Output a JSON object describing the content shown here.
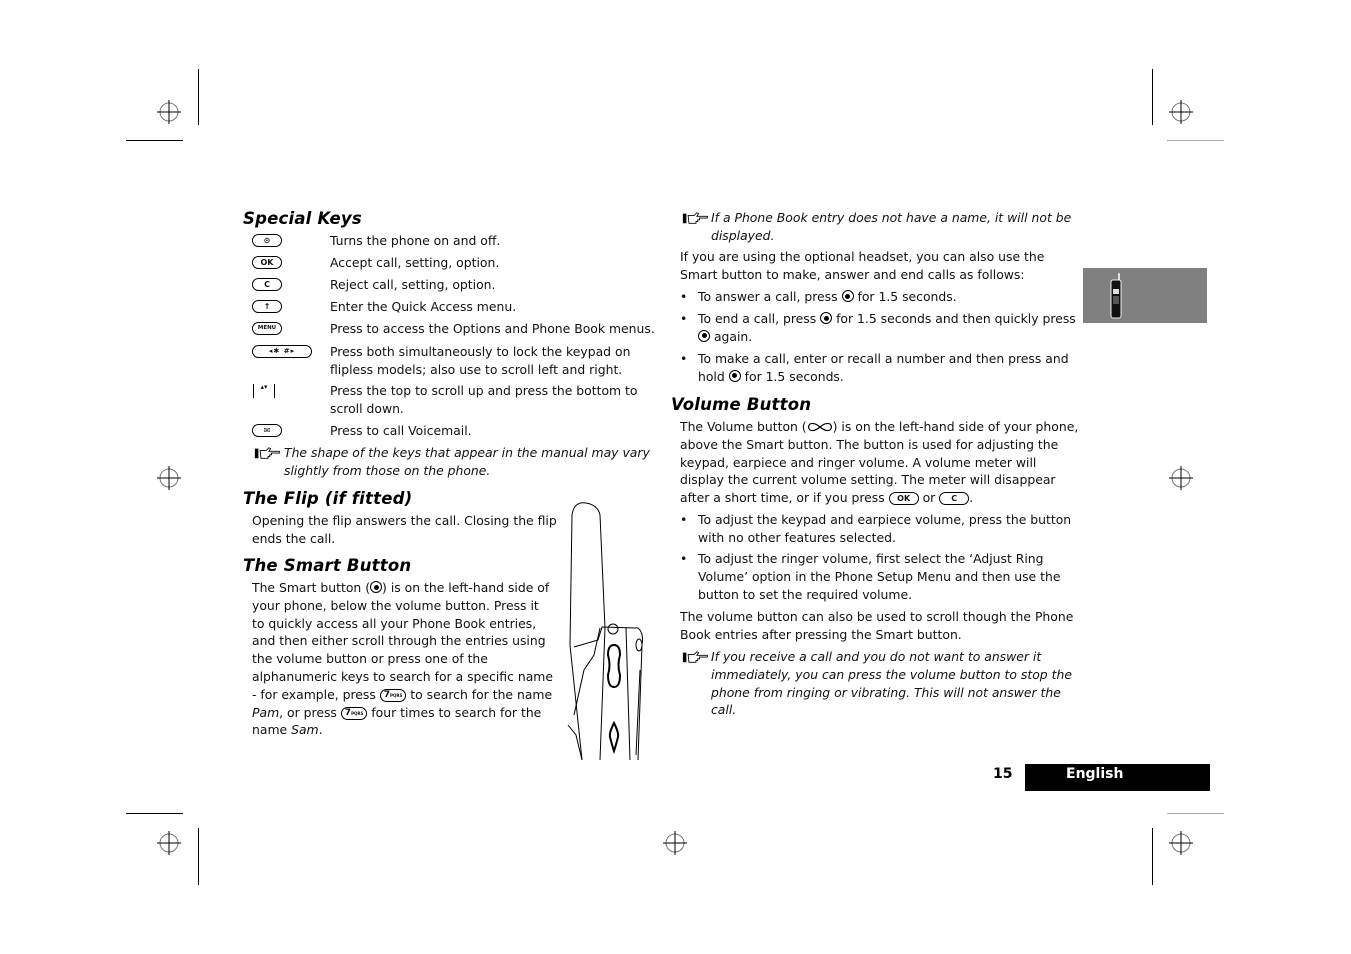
{
  "special_keys": {
    "heading": "Special Keys",
    "items": [
      {
        "icon": "power-key",
        "key_label": "⊙",
        "text": "Turns the phone on and off."
      },
      {
        "icon": "ok-key",
        "key_label": "OK",
        "text": "Accept call, setting, option."
      },
      {
        "icon": "clear-key",
        "key_label": "C",
        "text": "Reject call, setting, option."
      },
      {
        "icon": "quick-access-key",
        "key_label": "↑",
        "text": "Enter the Quick Access menu."
      },
      {
        "icon": "menu-key",
        "key_label": "MENU",
        "text": "Press to access the Options and Phone Book menus."
      },
      {
        "icon": "star-hash-keys",
        "key_label": "◂✱ #▸",
        "text": "Press both simultaneously to lock the keypad on flipless models; also use to scroll left and right."
      },
      {
        "icon": "scroll-key",
        "key_label": "▴▾",
        "text": "Press the top to scroll up and press the bottom to scroll down."
      },
      {
        "icon": "voicemail-key",
        "key_label": "✉",
        "text": "Press to call Voicemail."
      }
    ],
    "note": "The shape of the keys that appear in the manual may vary slightly from those on the phone."
  },
  "flip": {
    "heading": "The Flip (if fitted)",
    "text": "Opening the flip answers the call. Closing the flip ends the call."
  },
  "smart_button": {
    "heading": "The Smart Button",
    "text_1": "The Smart button (",
    "text_2": ") is on the left-hand side of your phone, below the volume button. Press it to quickly access all your Phone Book entries, and then either scroll through the entries using the volume button or press one of the alphanumeric keys to search for a specific name - for example, press ",
    "text_3": " to search for the name ",
    "name_1": "Pam",
    "text_4": ", or press ",
    "text_5": " four times to search for the name ",
    "name_2": "Sam",
    "text_6": ".",
    "key_7": "7",
    "key_7_sub": "PQRS"
  },
  "right_col": {
    "note_1": "If a Phone Book entry does not have a name, it will not be displayed.",
    "headset_intro": "If you are using the optional headset, you can also use the Smart button to make, answer and end calls as follows:",
    "bullets_smart": [
      {
        "a": "To answer a call, press ",
        "b": " for 1.5 seconds."
      },
      {
        "a": "To end a call, press ",
        "b": " for 1.5 seconds and then quickly press ",
        "c": " again."
      },
      {
        "a": "To make a call, enter or recall a number and then press and hold ",
        "b": " for 1.5 seconds."
      }
    ],
    "volume_heading": "Volume Button",
    "volume_text_1": "The Volume button (",
    "volume_text_2": ") is on the left-hand side of your phone, above the Smart button. The button is used for adjusting the keypad, earpiece and ringer volume. A volume meter will display the current volume setting. The meter will disappear after a short time, or if you press ",
    "volume_text_3": " or ",
    "volume_text_4": ".",
    "ok_label": "OK",
    "c_label": "C",
    "bullets_volume": [
      "To adjust the keypad and earpiece volume, press the button with no other features selected.",
      "To adjust the ringer volume, first select the ‘Adjust Ring Volume’ option in the Phone Setup Menu and then use the button to set the required volume."
    ],
    "scroll_text": "The volume button can also be used to scroll though the Phone Book entries after pressing the Smart button.",
    "note_2": "If you receive a call and you do not want to answer it immediately, you can press the volume button to stop the phone from ringing or vibrating. This will not answer the call."
  },
  "footer": {
    "page_number": "15",
    "language": "English"
  },
  "colors": {
    "tab_grey": "#808080",
    "footer_bar": "#000000"
  }
}
